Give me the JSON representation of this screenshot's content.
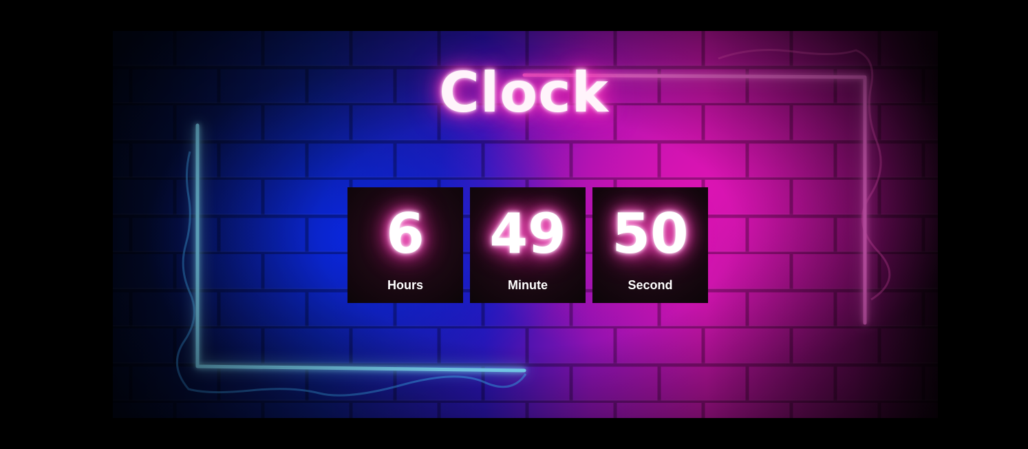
{
  "title": "Clock",
  "clock": {
    "hours": {
      "value": "6",
      "label": "Hours"
    },
    "minutes": {
      "value": "49",
      "label": "Minute"
    },
    "seconds": {
      "value": "50",
      "label": "Second"
    }
  },
  "colors": {
    "neon_blue": "#49c8ff",
    "neon_pink": "#ff2fc8",
    "text_glow": "#ff3fbe",
    "background": "#000000"
  }
}
